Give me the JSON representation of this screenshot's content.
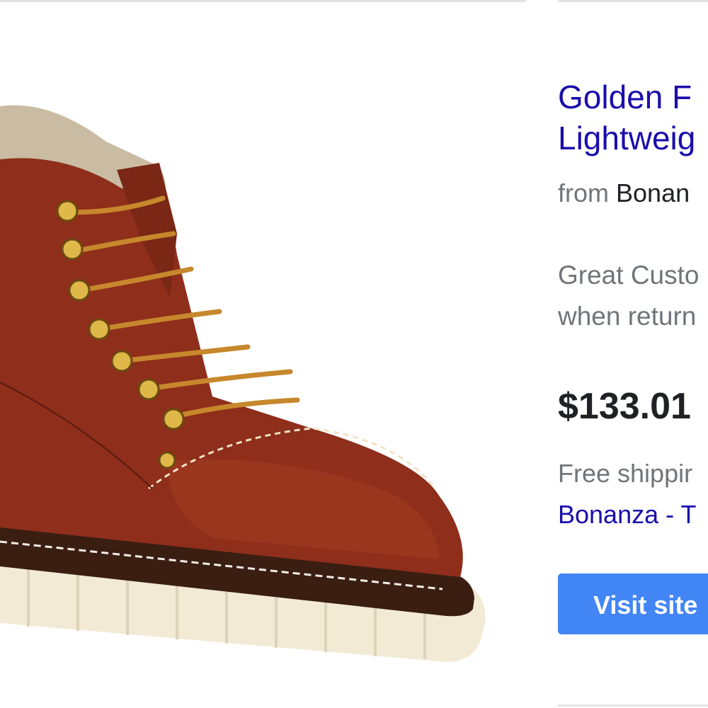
{
  "product": {
    "title_line1": "Golden F",
    "title_line2": "Lightweig",
    "image_icon": "work-boot-image"
  },
  "merchant": {
    "prefix": "from",
    "name": "Bonan"
  },
  "snippet": {
    "line1": "Great Custo",
    "line2": "when return"
  },
  "price": "$133.01",
  "shipping": "Free shippir",
  "store_link": "Bonanza - T",
  "visit_button": "Visit site",
  "colors": {
    "link": "#1a0dab",
    "button": "#4285f4",
    "muted_text": "#70757a",
    "dark_text": "#202124"
  }
}
